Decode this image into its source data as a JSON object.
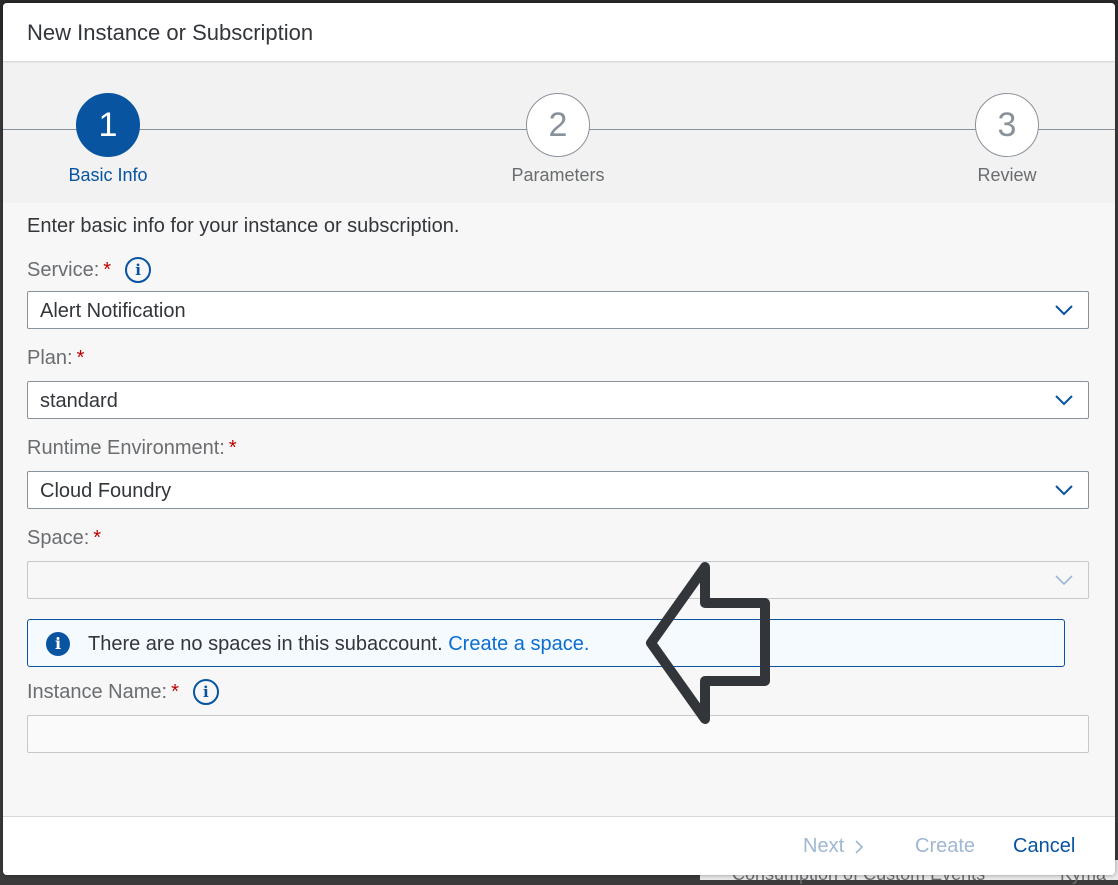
{
  "dialog": {
    "title": "New Instance or Subscription"
  },
  "wizard": {
    "steps": [
      {
        "number": "1",
        "label": "Basic Info",
        "active": true
      },
      {
        "number": "2",
        "label": "Parameters",
        "active": false
      },
      {
        "number": "3",
        "label": "Review",
        "active": false
      }
    ]
  },
  "form": {
    "intro": "Enter basic info for your instance or subscription.",
    "required_marker": "*",
    "service": {
      "label": "Service:",
      "value": "Alert Notification"
    },
    "plan": {
      "label": "Plan:",
      "value": "standard"
    },
    "runtime": {
      "label": "Runtime Environment:",
      "value": "Cloud Foundry"
    },
    "space": {
      "label": "Space:",
      "value": ""
    },
    "instance_name": {
      "label": "Instance Name:",
      "value": ""
    }
  },
  "message": {
    "text": "There are no spaces in this subaccount.",
    "link": "Create a space."
  },
  "footer": {
    "next_label": "Next",
    "create_label": "Create",
    "cancel_label": "Cancel"
  },
  "background": {
    "text_left": "Consumption of Custom Events",
    "text_right": "Kyma"
  },
  "colors": {
    "accent": "#0854a0",
    "link": "#0a6ed1",
    "required": "#bb0000",
    "message_bg": "#f5faff",
    "arrow": "#32363a"
  },
  "icons": {
    "info": "info-circle-icon",
    "dropdown": "chevron-down-icon",
    "next": "chevron-right-icon",
    "annotation": "outline-arrow-left-icon"
  }
}
